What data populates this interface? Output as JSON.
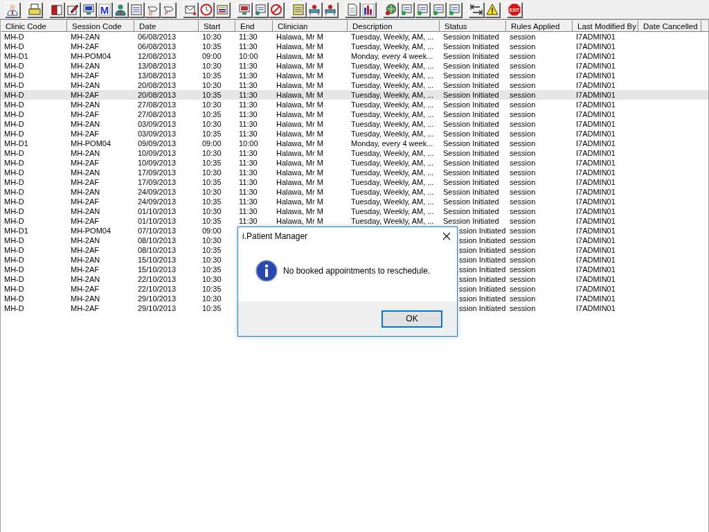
{
  "toolbar": [
    [
      {
        "kind": "doctor"
      }
    ],
    [
      {
        "kind": "printer"
      }
    ],
    [
      {
        "kind": "book"
      },
      {
        "kind": "edit"
      },
      {
        "kind": "monitor"
      },
      {
        "kind": "letter",
        "label": "M"
      },
      {
        "kind": "nurse"
      },
      {
        "kind": "note"
      },
      {
        "kind": "hand",
        "label": "D"
      },
      {
        "kind": "hand",
        "label": "P"
      }
    ],
    [
      {
        "kind": "envelope"
      },
      {
        "kind": "clock"
      },
      {
        "kind": "list"
      }
    ],
    [
      {
        "kind": "screen"
      },
      {
        "kind": "form"
      },
      {
        "kind": "no"
      }
    ],
    [
      {
        "kind": "notes"
      },
      {
        "kind": "bed"
      },
      {
        "kind": "bed"
      }
    ],
    [
      {
        "kind": "page"
      },
      {
        "kind": "chart"
      }
    ],
    [
      {
        "kind": "globe"
      },
      {
        "kind": "card"
      },
      {
        "kind": "card"
      },
      {
        "kind": "card"
      },
      {
        "kind": "card"
      }
    ],
    [
      {
        "kind": "arrows"
      },
      {
        "kind": "warning"
      }
    ],
    [
      {
        "kind": "stop",
        "label": "EXIT"
      }
    ]
  ],
  "table": {
    "columns": [
      "Clinic Code",
      "Session Code",
      "Date",
      "Start",
      "End",
      "Clinician",
      "Description",
      "Status",
      "Rules Applied",
      "Last Modified By",
      "Date Cancelled"
    ],
    "rows": [
      {
        "selected": false,
        "covered": false,
        "cells": [
          "MH-D",
          "MH-2AN",
          "06/08/2013",
          "10:30",
          "11:30",
          "Halawa, Mr M",
          "Tuesday, Weekly, AM, ...",
          "Session Initiated",
          "session",
          "I7ADMIN01"
        ]
      },
      {
        "selected": false,
        "covered": false,
        "cells": [
          "MH-D",
          "MH-2AF",
          "06/08/2013",
          "10:35",
          "11:30",
          "Halawa, Mr M",
          "Tuesday, Weekly, AM, ...",
          "Session Initiated",
          "session",
          "I7ADMIN01"
        ]
      },
      {
        "selected": false,
        "covered": false,
        "cells": [
          "MH-D1",
          "MH-POM04",
          "12/08/2013",
          "09:00",
          "10:00",
          "Halawa, Mr M",
          "Monday, every 4 week...",
          "Session Initiated",
          "session",
          "I7ADMIN01"
        ]
      },
      {
        "selected": false,
        "covered": false,
        "cells": [
          "MH-D",
          "MH-2AN",
          "13/08/2013",
          "10:30",
          "11:30",
          "Halawa, Mr M",
          "Tuesday, Weekly, AM, ...",
          "Session Initiated",
          "session",
          "I7ADMIN01"
        ]
      },
      {
        "selected": false,
        "covered": false,
        "cells": [
          "MH-D",
          "MH-2AF",
          "13/08/2013",
          "10:35",
          "11:30",
          "Halawa, Mr M",
          "Tuesday, Weekly, AM, ...",
          "Session Initiated",
          "session",
          "I7ADMIN01"
        ]
      },
      {
        "selected": false,
        "covered": false,
        "cells": [
          "MH-D",
          "MH-2AN",
          "20/08/2013",
          "10:30",
          "11:30",
          "Halawa, Mr M",
          "Tuesday, Weekly, AM, ...",
          "Session Initiated",
          "session",
          "I7ADMIN01"
        ]
      },
      {
        "selected": true,
        "covered": false,
        "cells": [
          "MH-D",
          "MH-2AF",
          "20/08/2013",
          "10:35",
          "11:30",
          "Halawa, Mr M",
          "Tuesday, Weekly, AM, ...",
          "Session Initiated",
          "session",
          "I7ADMIN01"
        ]
      },
      {
        "selected": false,
        "covered": false,
        "cells": [
          "MH-D",
          "MH-2AN",
          "27/08/2013",
          "10:30",
          "11:30",
          "Halawa, Mr M",
          "Tuesday, Weekly, AM, ...",
          "Session Initiated",
          "session",
          "I7ADMIN01"
        ]
      },
      {
        "selected": false,
        "covered": false,
        "cells": [
          "MH-D",
          "MH-2AF",
          "27/08/2013",
          "10:35",
          "11:30",
          "Halawa, Mr M",
          "Tuesday, Weekly, AM, ...",
          "Session Initiated",
          "session",
          "I7ADMIN01"
        ]
      },
      {
        "selected": false,
        "covered": false,
        "cells": [
          "MH-D",
          "MH-2AN",
          "03/09/2013",
          "10:30",
          "11:30",
          "Halawa, Mr M",
          "Tuesday, Weekly, AM, ...",
          "Session Initiated",
          "session",
          "I7ADMIN01"
        ]
      },
      {
        "selected": false,
        "covered": false,
        "cells": [
          "MH-D",
          "MH-2AF",
          "03/09/2013",
          "10:35",
          "11:30",
          "Halawa, Mr M",
          "Tuesday, Weekly, AM, ...",
          "Session Initiated",
          "session",
          "I7ADMIN01"
        ]
      },
      {
        "selected": false,
        "covered": false,
        "cells": [
          "MH-D1",
          "MH-POM04",
          "09/09/2013",
          "09:00",
          "10:00",
          "Halawa, Mr M",
          "Monday, every 4 week...",
          "Session Initiated",
          "session",
          "I7ADMIN01"
        ]
      },
      {
        "selected": false,
        "covered": false,
        "cells": [
          "MH-D",
          "MH-2AN",
          "10/09/2013",
          "10:30",
          "11:30",
          "Halawa, Mr M",
          "Tuesday, Weekly, AM, ...",
          "Session Initiated",
          "session",
          "I7ADMIN01"
        ]
      },
      {
        "selected": false,
        "covered": false,
        "cells": [
          "MH-D",
          "MH-2AF",
          "10/09/2013",
          "10:35",
          "11:30",
          "Halawa, Mr M",
          "Tuesday, Weekly, AM, ...",
          "Session Initiated",
          "session",
          "I7ADMIN01"
        ]
      },
      {
        "selected": false,
        "covered": false,
        "cells": [
          "MH-D",
          "MH-2AN",
          "17/09/2013",
          "10:30",
          "11:30",
          "Halawa, Mr M",
          "Tuesday, Weekly, AM, ...",
          "Session Initiated",
          "session",
          "I7ADMIN01"
        ]
      },
      {
        "selected": false,
        "covered": false,
        "cells": [
          "MH-D",
          "MH-2AF",
          "17/09/2013",
          "10:35",
          "11:30",
          "Halawa, Mr M",
          "Tuesday, Weekly, AM, ...",
          "Session Initiated",
          "session",
          "I7ADMIN01"
        ]
      },
      {
        "selected": false,
        "covered": false,
        "cells": [
          "MH-D",
          "MH-2AN",
          "24/09/2013",
          "10:30",
          "11:30",
          "Halawa, Mr M",
          "Tuesday, Weekly, AM, ...",
          "Session Initiated",
          "session",
          "I7ADMIN01"
        ]
      },
      {
        "selected": false,
        "covered": false,
        "cells": [
          "MH-D",
          "MH-2AF",
          "24/09/2013",
          "10:35",
          "11:30",
          "Halawa, Mr M",
          "Tuesday, Weekly, AM, ...",
          "Session Initiated",
          "session",
          "I7ADMIN01"
        ]
      },
      {
        "selected": false,
        "covered": false,
        "cells": [
          "MH-D",
          "MH-2AN",
          "01/10/2013",
          "10:30",
          "11:30",
          "Halawa, Mr M",
          "Tuesday, Weekly, AM, ...",
          "Session Initiated",
          "session",
          "I7ADMIN01"
        ]
      },
      {
        "selected": false,
        "covered": false,
        "cells": [
          "MH-D",
          "MH-2AF",
          "01/10/2013",
          "10:35",
          "11:30",
          "Halawa, Mr M",
          "Tuesday, Weekly, AM, ...",
          "Session Initiated",
          "session",
          "I7ADMIN01"
        ]
      },
      {
        "selected": false,
        "covered": true,
        "cells": [
          "MH-D1",
          "MH-POM04",
          "07/10/2013",
          "09:00",
          "",
          "",
          "",
          "ssion Initiated",
          "session",
          "I7ADMIN01"
        ]
      },
      {
        "selected": false,
        "covered": true,
        "cells": [
          "MH-D",
          "MH-2AN",
          "08/10/2013",
          "10:30",
          "",
          "",
          "",
          "ssion Initiated",
          "session",
          "I7ADMIN01"
        ]
      },
      {
        "selected": false,
        "covered": true,
        "cells": [
          "MH-D",
          "MH-2AF",
          "08/10/2013",
          "10:35",
          "",
          "",
          "",
          "ssion Initiated",
          "session",
          "I7ADMIN01"
        ]
      },
      {
        "selected": false,
        "covered": true,
        "cells": [
          "MH-D",
          "MH-2AN",
          "15/10/2013",
          "10:30",
          "",
          "",
          "",
          "ssion Initiated",
          "session",
          "I7ADMIN01"
        ]
      },
      {
        "selected": false,
        "covered": true,
        "cells": [
          "MH-D",
          "MH-2AF",
          "15/10/2013",
          "10:35",
          "",
          "",
          "",
          "ssion Initiated",
          "session",
          "I7ADMIN01"
        ]
      },
      {
        "selected": false,
        "covered": true,
        "cells": [
          "MH-D",
          "MH-2AN",
          "22/10/2013",
          "10:30",
          "",
          "",
          "",
          "ssion Initiated",
          "session",
          "I7ADMIN01"
        ]
      },
      {
        "selected": false,
        "covered": true,
        "cells": [
          "MH-D",
          "MH-2AF",
          "22/10/2013",
          "10:35",
          "",
          "",
          "",
          "ssion Initiated",
          "session",
          "I7ADMIN01"
        ]
      },
      {
        "selected": false,
        "covered": true,
        "cells": [
          "MH-D",
          "MH-2AN",
          "29/10/2013",
          "10:30",
          "",
          "",
          "",
          "ssion Initiated",
          "session",
          "I7ADMIN01"
        ]
      },
      {
        "selected": false,
        "covered": true,
        "cells": [
          "MH-D",
          "MH-2AF",
          "29/10/2013",
          "10:35",
          "",
          "",
          "",
          "ssion Initiated",
          "session",
          "I7ADMIN01"
        ]
      }
    ]
  },
  "dialog": {
    "title": "i.Patient Manager",
    "message": "No booked appointments to reschedule.",
    "buttons": [
      "OK"
    ]
  }
}
